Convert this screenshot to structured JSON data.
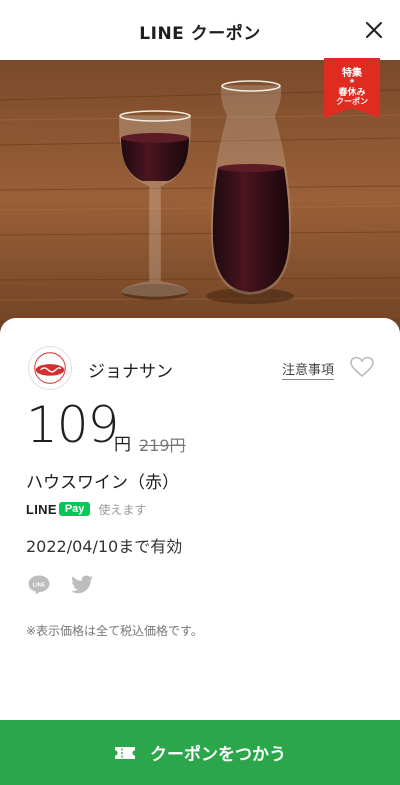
{
  "header": {
    "title": "LINE クーポン",
    "close_icon": "close-icon"
  },
  "hero": {
    "image": "red wine glass and carafe on wooden table",
    "ribbon": {
      "line1": "特集",
      "star": "★",
      "line2": "春休み",
      "line3": "クーポン",
      "color": "#e02b20"
    }
  },
  "store": {
    "name": "ジョナサン",
    "notes_label": "注意事項",
    "favorite_icon": "heart-icon"
  },
  "offer": {
    "price": "109",
    "price_unit": "円",
    "original_price": "219円",
    "product": "ハウスワイン（赤）",
    "payment": {
      "brand": "LINE",
      "pay": "Pay",
      "usable_label": "使えます"
    },
    "expiry": "2022/04/10まで有効",
    "note": "※表示価格は全て税込価格です。"
  },
  "share": {
    "line_icon": "line-share-icon",
    "twitter_icon": "twitter-icon"
  },
  "cta": {
    "label": "クーポンをつかう",
    "icon": "ticket-icon",
    "color": "#2ca64a"
  }
}
